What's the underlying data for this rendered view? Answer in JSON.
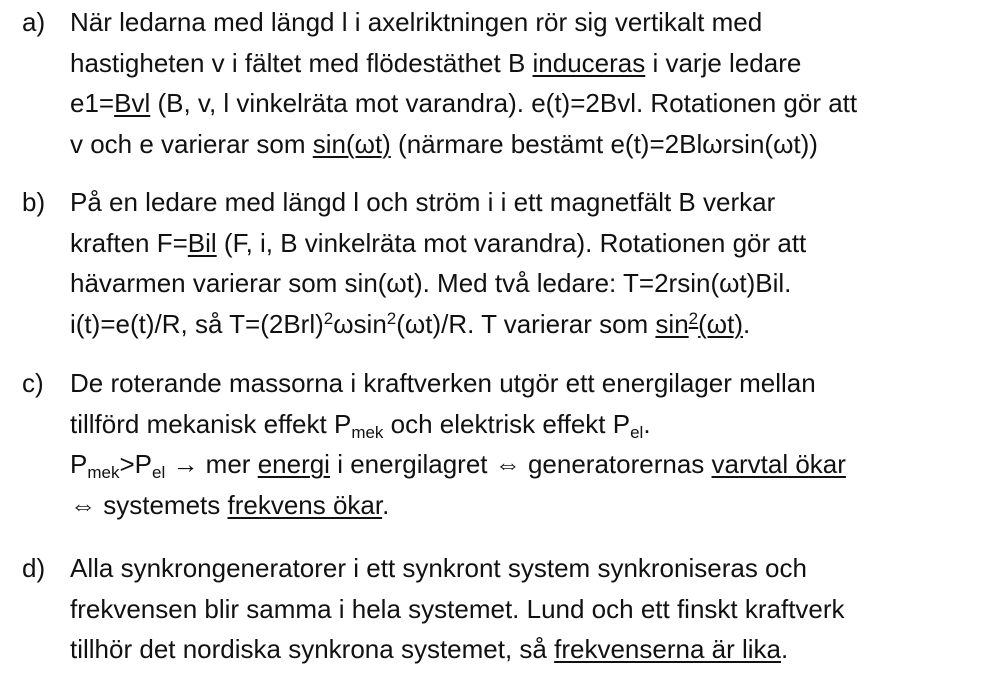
{
  "items": [
    {
      "marker": "a)",
      "lines": [
        [
          {
            "t": "När ledarna med längd l i axelriktningen rör sig vertikalt med"
          }
        ],
        [
          {
            "t": "hastigheten v i fältet med flödestäthet B "
          },
          {
            "t": "induceras",
            "s": "u"
          },
          {
            "t": " i varje ledare"
          }
        ],
        [
          {
            "t": "e1="
          },
          {
            "t": "Bvl",
            "s": "u"
          },
          {
            "t": " (B, v, l vinkelräta mot varandra). e(t)=2Bvl. Rotationen gör att"
          }
        ],
        [
          {
            "t": "v och e varierar som "
          },
          {
            "t": "sin(ωt)",
            "s": "u"
          },
          {
            "t": " (närmare bestämt e(t)=2Blωrsin(ωt))"
          }
        ]
      ]
    },
    {
      "marker": "b)",
      "lines": [
        [
          {
            "t": "På en ledare med längd l och ström i i ett magnetfält B verkar"
          }
        ],
        [
          {
            "t": "kraften F="
          },
          {
            "t": "Bil",
            "s": "u"
          },
          {
            "t": " (F, i, B vinkelräta mot varandra). Rotationen gör att"
          }
        ],
        [
          {
            "t": "hävarmen varierar som sin(ωt). Med två ledare: T=2rsin(ωt)Bil."
          }
        ],
        [
          {
            "t": "i(t)=e(t)/R, så T=(2Brl)"
          },
          {
            "t": "2",
            "s": "sup"
          },
          {
            "t": "ωsin"
          },
          {
            "t": "2",
            "s": "sup"
          },
          {
            "t": "(ωt)/R. T varierar som "
          },
          {
            "t": "sin",
            "s": "u"
          },
          {
            "t": "2",
            "s": "u sup"
          },
          {
            "t": "(ωt)",
            "s": "u"
          },
          {
            "t": "."
          }
        ]
      ]
    },
    {
      "marker": "c)",
      "lines": [
        [
          {
            "t": "De roterande massorna i kraftverken utgör ett energilager mellan"
          }
        ],
        [
          {
            "t": "tillförd mekanisk effekt P"
          },
          {
            "t": "mek",
            "s": "sub"
          },
          {
            "t": " och elektrisk effekt P"
          },
          {
            "t": "el",
            "s": "sub"
          },
          {
            "t": "."
          }
        ],
        [
          {
            "t": "P"
          },
          {
            "t": "mek",
            "s": "sub"
          },
          {
            "t": ">P"
          },
          {
            "t": "el",
            "s": "sub"
          },
          {
            "t": " → mer "
          },
          {
            "t": "energi",
            "s": "u"
          },
          {
            "t": " i energilagret ⇔ generatorernas "
          },
          {
            "t": "varvtal ökar",
            "s": "u"
          }
        ],
        [
          {
            "t": "⇔ systemets "
          },
          {
            "t": "frekvens ökar",
            "s": "u"
          },
          {
            "t": "."
          }
        ]
      ]
    },
    {
      "marker": "d)",
      "lines": [
        [
          {
            "t": "Alla synkrongeneratorer i ett synkront system synkroniseras och"
          }
        ],
        [
          {
            "t": "frekvensen blir samma i hela systemet. Lund och ett finskt kraftverk"
          }
        ],
        [
          {
            "t": "tillhör det nordiska synkrona systemet, så "
          },
          {
            "t": "frekvenserna är lika",
            "s": "u"
          },
          {
            "t": "."
          }
        ]
      ]
    }
  ]
}
